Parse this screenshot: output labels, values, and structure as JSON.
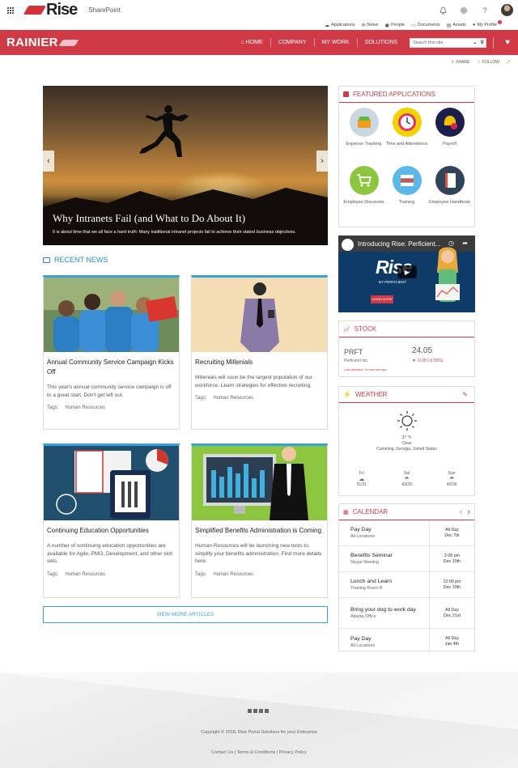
{
  "suite": {
    "product": "Rise",
    "app": "SharePoint"
  },
  "quicklinks": [
    "Applications",
    "News",
    "People",
    "Documents",
    "Assets",
    "My Profile"
  ],
  "profile_badge": "!",
  "nav": {
    "brand": "RAINIER",
    "items": [
      "HOME",
      "COMPANY",
      "MY WORK",
      "SOLUTIONS"
    ],
    "search_placeholder": "Search this site"
  },
  "actions": {
    "share": "SHARE",
    "follow": "FOLLOW"
  },
  "hero": {
    "title": "Why Intranets Fail (and What to Do About It)",
    "subtitle": "It is about time that we all face a hard truth: Many traditional intranet projects fail to achieve their stated business objectives."
  },
  "news": {
    "heading": "RECENT NEWS",
    "tags_label": "Tags:",
    "articles": [
      {
        "title": "Annual Community Service Campaign Kicks Off",
        "desc": "This year's annual community service campaign is off to a great start. Don't get left out.",
        "tag": "Human Resources"
      },
      {
        "title": "Recruiting Millenials",
        "desc": "Millenials will soon be the largest population of our workforce. Learn strategies for effective recruiting.",
        "tag": "Human Resources"
      },
      {
        "title": "Continuing Education Opportunities",
        "desc": "A number of continuing education opportunities are available for Agile, PMO, Development, and other skill sets.",
        "tag": "Human Resources"
      },
      {
        "title": "Simplified Benefits Administration is Coming",
        "desc": "Human Resources will be launching new tools to simplify your benefits administration. Find more details here.",
        "tag": "Human Resources"
      }
    ],
    "view_more": "VIEW MORE ARTICLES"
  },
  "featured": {
    "heading": "FEATURED APPLICATIONS",
    "apps": [
      {
        "label": "Expense Tracking",
        "color": "#c9d8e0"
      },
      {
        "label": "Time and Attendence",
        "color": "#f2d200"
      },
      {
        "label": "Payroll",
        "color": "#1b1f4e"
      },
      {
        "label": "Employee Discounts",
        "color": "#8cc63f"
      },
      {
        "label": "Training",
        "color": "#5cb8e6"
      },
      {
        "label": "Employee Handbook",
        "color": "#2f4458"
      }
    ]
  },
  "video": {
    "title": "Introducing Rise: Perficient...",
    "brand": "Rise",
    "by": "BY PERFICIENT",
    "button": "LEARN MORE"
  },
  "stock": {
    "heading": "STOCK",
    "symbol": "PRFT",
    "company": "Perficient Inc.",
    "price": "24.05",
    "change": "▼ -0.08 (-0.33%)",
    "updated": "Last updated: 10 minutes ago"
  },
  "weather": {
    "heading": "WEATHER",
    "temp": "37 °F",
    "condition": "Clear",
    "location": "Cumming, Georgia, United States",
    "days": [
      {
        "day": "Fri",
        "range": "51/31"
      },
      {
        "day": "Sat",
        "range": "43/39"
      },
      {
        "day": "Sun",
        "range": "40/39"
      }
    ]
  },
  "calendar": {
    "heading": "CALENDAR",
    "events": [
      {
        "title": "Pay Day",
        "loc": "All Locations",
        "time": "All Day",
        "date": "Dec 7th"
      },
      {
        "title": "Benefits Seminar",
        "loc": "Skype Meeting",
        "time": "2:00 pm",
        "date": "Dec 10th"
      },
      {
        "title": "Lunch and Learn",
        "loc": "Training Room B",
        "time": "12:00 pm",
        "date": "Dec 19th"
      },
      {
        "title": "Bring your dog to work day",
        "loc": "Atlanta Office",
        "time": "All Day",
        "date": "Dec 21st"
      },
      {
        "title": "Pay Day",
        "loc": "All Locations",
        "time": "All Day",
        "date": "Jan 4th"
      }
    ]
  },
  "footer": {
    "copyright": "Copyright © 2018, Rise Portal Solutions for your Enterprise",
    "links": "Contact Us | Terms & Conditions | Privacy Policy"
  }
}
